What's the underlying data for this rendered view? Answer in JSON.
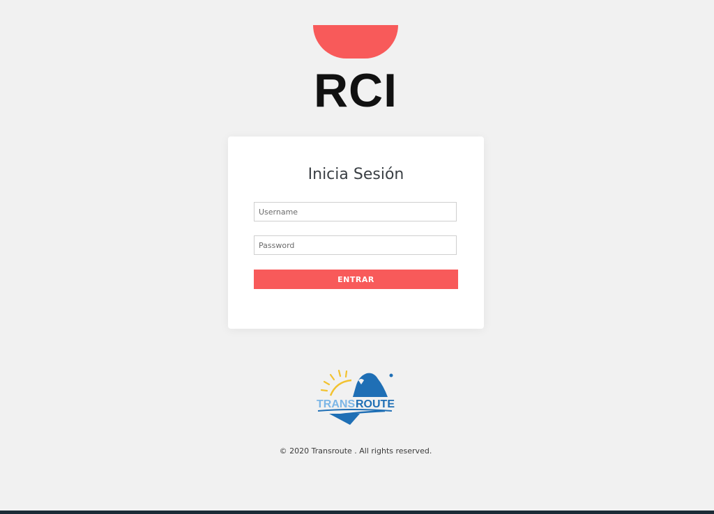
{
  "brand": {
    "logo_text": "RCI",
    "accent_color": "#f85a5a"
  },
  "login": {
    "title": "Inicia Sesión",
    "username_placeholder": "Username",
    "password_placeholder": "Password",
    "submit_label": "ENTRAR"
  },
  "footer": {
    "partner_logo_text": [
      "TRANS",
      "ROUTE"
    ],
    "copyright": "© 2020 Transroute . All rights reserved."
  },
  "colors": {
    "background": "#f1f1f1",
    "card": "#ffffff",
    "bottom_bar": "#1b2b36",
    "transroute_blue": "#1f6fb5",
    "transroute_yellow": "#f2c230"
  }
}
